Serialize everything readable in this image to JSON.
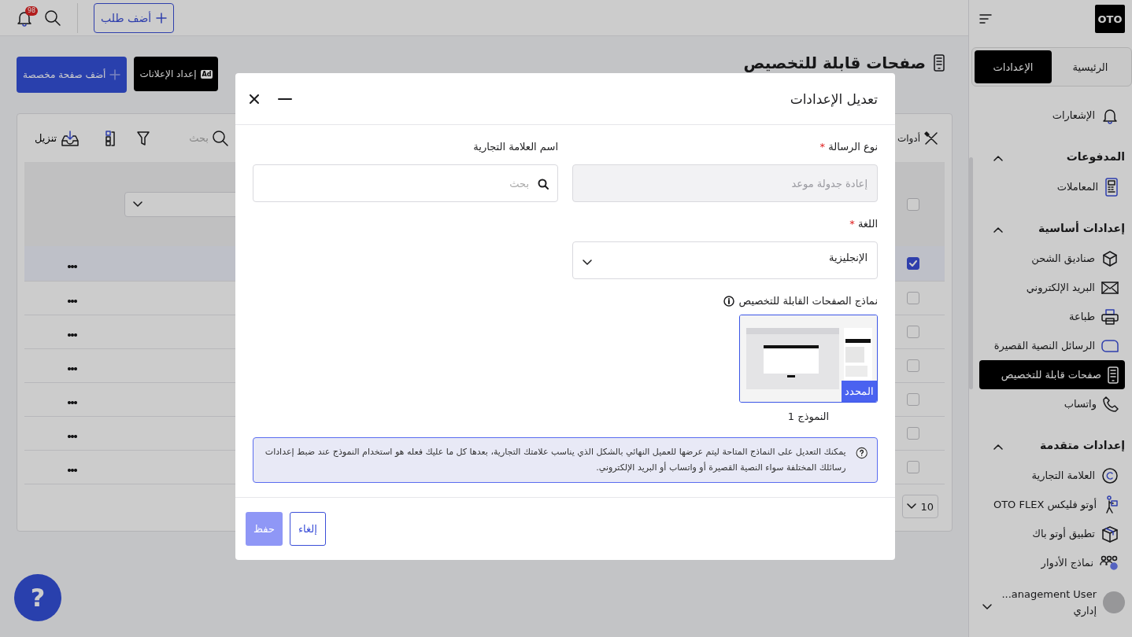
{
  "topbar": {
    "add_order_button": "أضف طلب",
    "notification_count": "98"
  },
  "page": {
    "title": "صفحات قابلة للتخصيص",
    "ads_badge": "Ad",
    "ads_button": "إعداد الإعلانات",
    "add_page_button": "أضف صفحة مخصصة"
  },
  "toolbar": {
    "tools": "أدوات",
    "search_placeholder": "بحث",
    "download": "تنزيل"
  },
  "table": {
    "header": {
      "checked": false
    },
    "rows": [
      {
        "selected": true,
        "checked": true
      },
      {
        "selected": false,
        "checked": false
      },
      {
        "selected": false,
        "checked": false
      },
      {
        "selected": false,
        "checked": false
      },
      {
        "selected": false,
        "checked": false
      },
      {
        "selected": false,
        "checked": false
      },
      {
        "selected": false,
        "checked": false
      }
    ]
  },
  "pagination": {
    "page_size": "10"
  },
  "help_button": "?",
  "sidebar": {
    "logo": "OTO",
    "tabs": [
      {
        "label": "الرئيسية",
        "selected": false
      },
      {
        "label": "الإعدادات",
        "selected": true
      }
    ],
    "groups": [
      {
        "items": [
          {
            "label": "الإشعارات",
            "selected": false
          }
        ]
      },
      {
        "title": "المدفوعات",
        "expanded": true,
        "items": [
          {
            "label": "المعاملات",
            "selected": false
          }
        ]
      },
      {
        "title": "إعدادات أساسية",
        "expanded": true,
        "items": [
          {
            "label": "صناديق الشحن",
            "selected": false
          },
          {
            "label": "البريد الإلكتروني",
            "selected": false
          },
          {
            "label": "طباعة",
            "selected": false
          },
          {
            "label": "الرسائل النصية القصيرة",
            "selected": false
          },
          {
            "label": "صفحات قابلة للتخصيص",
            "selected": true
          },
          {
            "label": "واتساب",
            "selected": false
          }
        ]
      },
      {
        "title": "إعدادات متقدمة",
        "expanded": true,
        "items": [
          {
            "label": "العلامة التجارية",
            "selected": false
          },
          {
            "label": "أوتو فليكس OTO FLEX",
            "selected": false
          },
          {
            "label": "تطبيق أوتو باك",
            "selected": false
          },
          {
            "label": "نماذج الأدوار",
            "selected": false
          }
        ]
      }
    ],
    "user": {
      "name": "...anagement User",
      "role": "إداري"
    }
  },
  "modal": {
    "title": "تعديل الإعدادات",
    "message_type": {
      "label": "نوع الرسالة",
      "required_mark": "*",
      "value": "إعادة جدولة موعد",
      "disabled": true
    },
    "brand_name": {
      "label": "اسم العلامة التجارية",
      "placeholder": "بحث"
    },
    "language": {
      "label": "اللغة",
      "required_mark": "*",
      "value": "الإنجليزية"
    },
    "templates_label": "نماذج الصفحات القابلة للتخصيص",
    "templates": [
      {
        "caption": "النموذج 1",
        "selected": true,
        "badge": "المحدد"
      }
    ],
    "info": "يمكنك التعديل على النماذج المتاحة ليتم عرضها للعميل النهائي بالشكل الذي يناسب علامتك التجارية، بعدها كل ما عليك فعله هو استخدام النموذج عند ضبط إعدادات رسائلك المختلفة سواء النصية القصيرة أو واتساب أو البريد الإلكتروني.",
    "buttons": [
      {
        "label": "إلغاء",
        "kind": "secondary",
        "disabled": false
      },
      {
        "label": "حفظ",
        "kind": "primary",
        "disabled": true
      }
    ]
  }
}
